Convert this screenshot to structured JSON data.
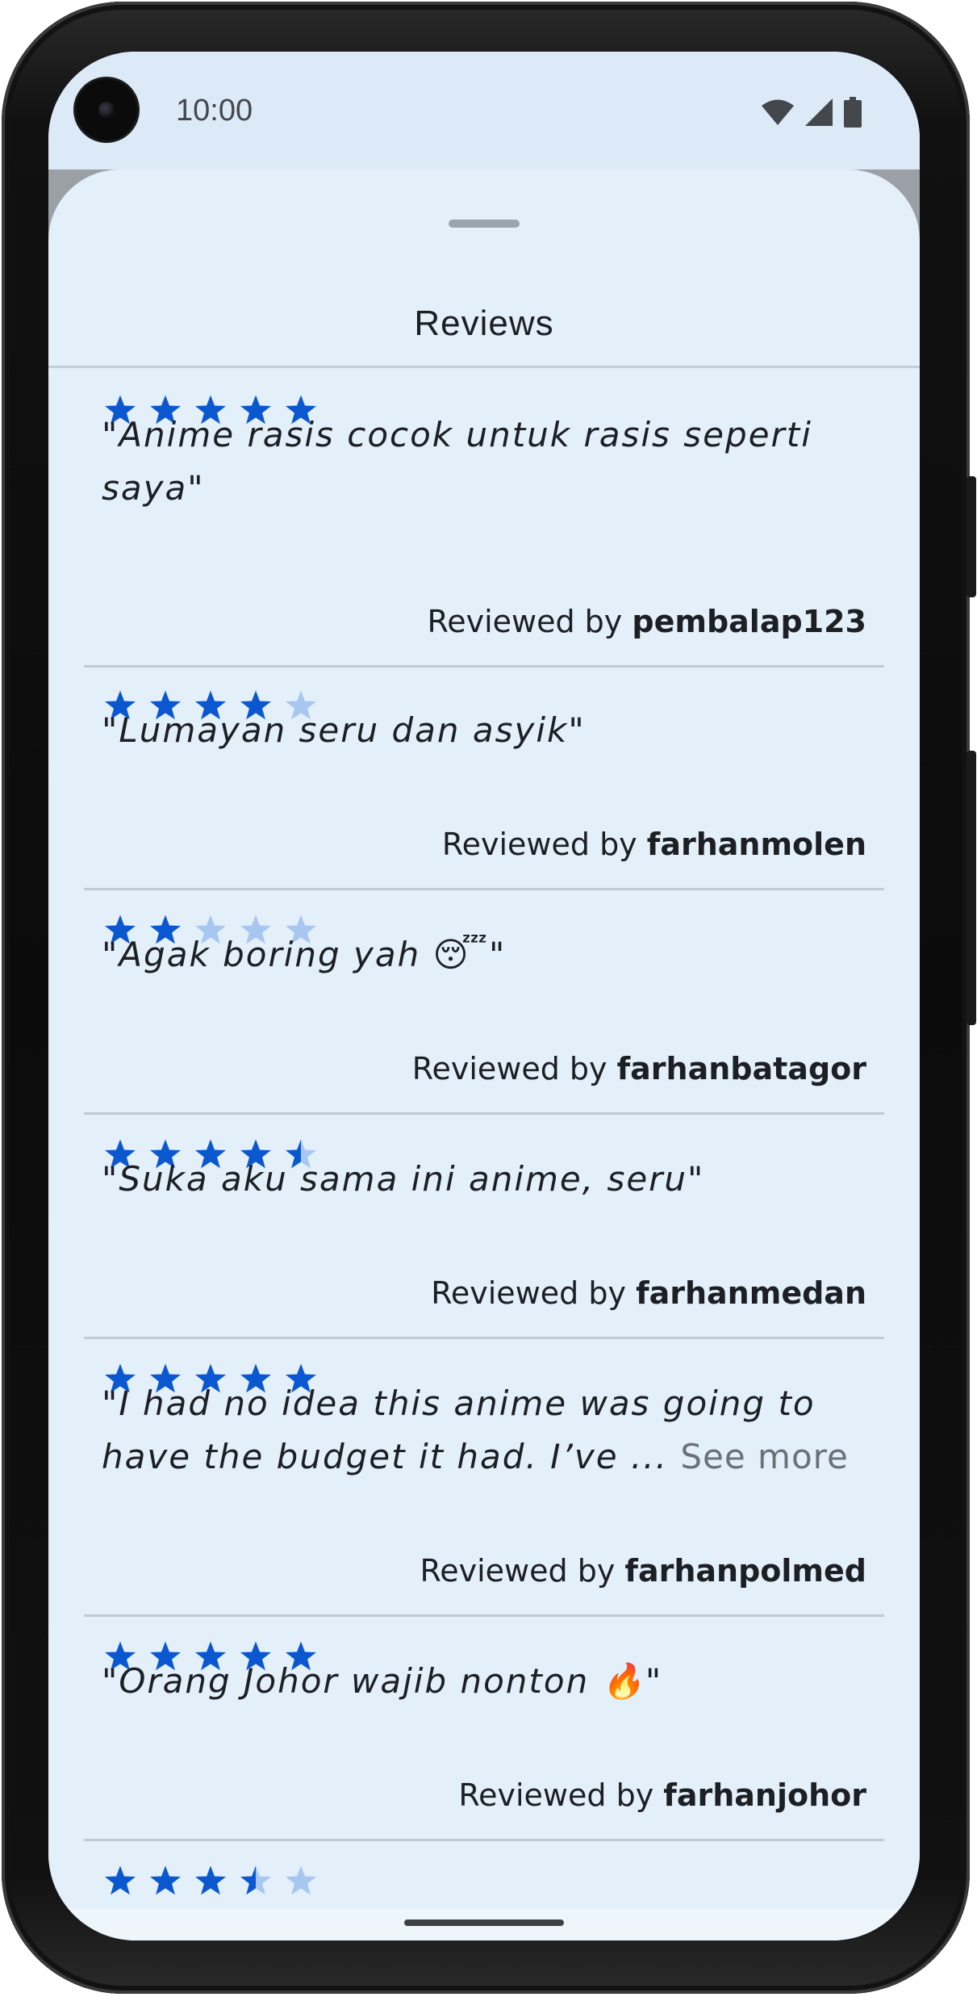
{
  "status_bar": {
    "time": "10:00",
    "icons": [
      "wifi-icon",
      "signal-icon",
      "battery-icon"
    ]
  },
  "sheet": {
    "title": "Reviews"
  },
  "reviews": [
    {
      "rating": 5,
      "text": "\"Anime rasis cocok untuk rasis seperti saya\"",
      "reviewed_by_label": "Reviewed by",
      "username": "pembalap123"
    },
    {
      "rating": 4,
      "text": "\"Lumayan seru dan asyik\"",
      "reviewed_by_label": "Reviewed by",
      "username": "farhanmolen"
    },
    {
      "rating": 2,
      "text": "\"Agak boring yah 😴\"",
      "reviewed_by_label": "Reviewed by",
      "username": "farhanbatagor"
    },
    {
      "rating": 4.5,
      "text": "\"Suka aku sama ini anime, seru\"",
      "reviewed_by_label": "Reviewed by",
      "username": "farhanmedan"
    },
    {
      "rating": 5,
      "text": "\"I had no idea this anime was going to have the budget it had. I’ve",
      "ellipsis": "...",
      "see_more": "See more",
      "reviewed_by_label": "Reviewed by",
      "username": "farhanpolmed"
    },
    {
      "rating": 5,
      "text": "\"Orang Johor wajib nonton 🔥\"",
      "reviewed_by_label": "Reviewed by",
      "username": "farhanjohor"
    },
    {
      "rating": 3.5
    }
  ],
  "colors": {
    "star_filled": "#0b57d0",
    "star_empty": "#a8c7f0",
    "sheet_bg": "#e3eff9",
    "status_bg": "#dce9f7"
  }
}
